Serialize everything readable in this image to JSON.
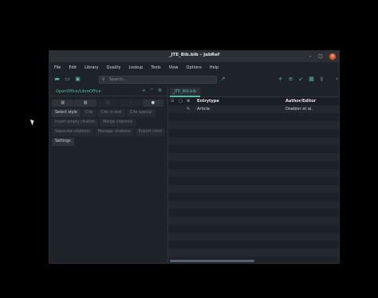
{
  "window": {
    "title": "_JTE_Bib.bib – JabRef"
  },
  "menubar": [
    "File",
    "Edit",
    "Library",
    "Quality",
    "Lookup",
    "Tools",
    "View",
    "Options",
    "Help"
  ],
  "search": {
    "placeholder": "Search..."
  },
  "ooo": {
    "title": "OpenOffice/LibreOffice",
    "row1": [
      "Select style",
      "Cite",
      "Cite in-text",
      "Cite special"
    ],
    "row2": [
      "Insert empty citation",
      "Merge citations"
    ],
    "row3": [
      "Separate citations",
      "Manage citations",
      "Export cited"
    ],
    "row4": [
      "Settings"
    ]
  },
  "tab": {
    "label": "_JTE_Bib.bib"
  },
  "table": {
    "headers": [
      "Entrytype",
      "Author/Editor"
    ],
    "rows": [
      {
        "entrytype": "Article",
        "author": "Doebler et al."
      }
    ]
  },
  "colors": {
    "accent": "#4fb9a6",
    "close": "#e95420",
    "bg": "#1e2229"
  }
}
